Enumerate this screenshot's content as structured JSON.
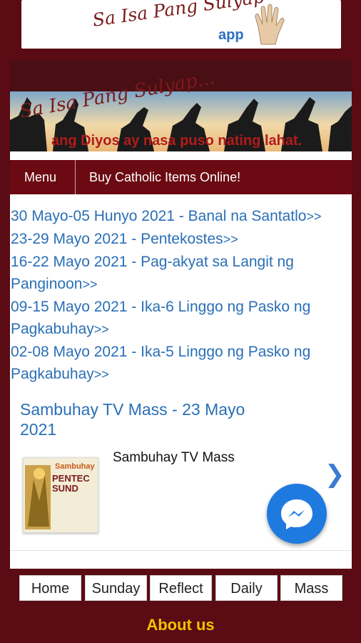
{
  "app_banner": {
    "title": "Sa Isa Pang Sulyap",
    "subtitle": "app"
  },
  "hero": {
    "title": "Sa Isa Pang Sulyap...",
    "subtitle": "ang Diyos ay nasa puso nating lahat."
  },
  "nav": {
    "menu_label": "Menu",
    "buy_label": "Buy Catholic Items Online!"
  },
  "links": [
    {
      "text": "30 Mayo-05 Hunyo 2021 - Banal na Santatlo",
      "arrow": ">>"
    },
    {
      "text": "23-29 Mayo 2021 - Pentekostes",
      "arrow": ">>"
    },
    {
      "text": "16-22 Mayo 2021 - Pag-akyat sa Langit ng Panginoon",
      "arrow": ">>"
    },
    {
      "text": "09-15 Mayo 2021 - Ika-6 Linggo ng Pasko ng Pagkabuhay",
      "arrow": ">>"
    },
    {
      "text": "02-08 Mayo 2021 - Ika-5 Linggo ng Pasko ng Pagkabuhay",
      "arrow": ">>"
    }
  ],
  "mass": {
    "title": "Sambuhay TV Mass - 23 Mayo 2021",
    "item_label": "Sambuhay TV Mass",
    "thumb_brand": "Sambuhay",
    "thumb_text": "PENTEC SUND",
    "next_icon": "chevron-right-icon"
  },
  "tabs": [
    {
      "label": "Home"
    },
    {
      "label": "Sunday"
    },
    {
      "label": "Reflect"
    },
    {
      "label": "Daily"
    },
    {
      "label": "Mass"
    }
  ],
  "footer": {
    "about_label": "About us"
  },
  "colors": {
    "background": "#5a0b13",
    "nav": "#6b0a12",
    "link": "#2a6fb6",
    "about": "#f2c200",
    "messenger": "#1f7ae0"
  }
}
